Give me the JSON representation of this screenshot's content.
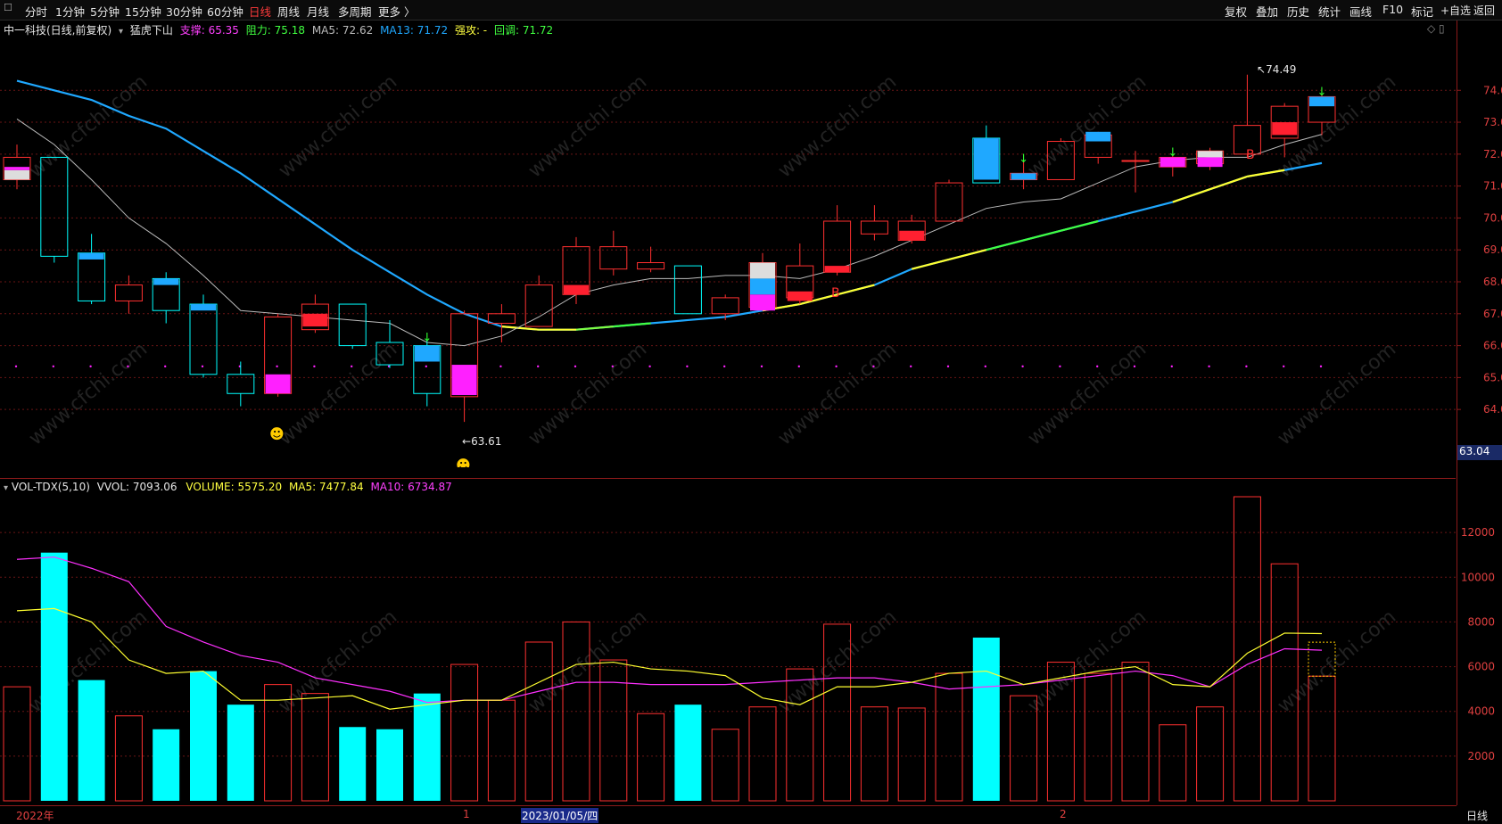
{
  "toolbar": {
    "periods": [
      "分时",
      "1分钟",
      "5分钟",
      "15分钟",
      "30分钟",
      "60分钟",
      "日线",
      "周线",
      "月线",
      "多周期",
      "更多 〉"
    ],
    "active_period": "日线",
    "right_buttons": [
      "复权",
      "叠加",
      "历史",
      "统计",
      "画线",
      "F10",
      "标记",
      "+自选",
      "返回"
    ]
  },
  "price_panel": {
    "stock_title": "中一科技(日线,前复权)",
    "indicator_name": "猛虎下山",
    "support_label": "支撑: 65.35",
    "resistance_label": "阻力: 75.18",
    "ma5_label": "MA5: 72.62",
    "ma13_label": "MA13: 71.72",
    "strong_attack_label": "强攻: -",
    "pullback_label": "回调: 71.72",
    "high_annotation": "74.49",
    "low_annotation": "63.61",
    "current_price_tag": "63.04",
    "buy_marker": "B"
  },
  "volume_panel": {
    "indicator_name": "VOL-TDX(5,10)",
    "vvol_label": "VVOL: 7093.06",
    "volume_label": "VOLUME: 5575.20",
    "ma5_label": "MA5: 7477.84",
    "ma10_label": "MA10: 6734.87"
  },
  "x_axis": {
    "year_label": "2022年",
    "month1_label": "1",
    "cursor_date": "2023/01/05/四",
    "month2_label": "2",
    "period_label": "日线"
  },
  "watermark": "www.cfchi.com",
  "colors": {
    "up": "#ff3030",
    "down": "#00ffff",
    "ma13": "#1fa8ff",
    "ma5": "#bbbbbb",
    "volume_ma5": "#ffff30",
    "volume_ma10": "#ff30ff",
    "accent_magenta": "#ff20ff"
  },
  "chart_data": [
    {
      "type": "candlestick",
      "y_ticks": [
        64.0,
        65.0,
        66.0,
        67.0,
        68.0,
        69.0,
        70.0,
        71.0,
        72.0,
        73.0,
        74.0
      ],
      "ylim": [
        62.3,
        75.6
      ],
      "support_level": 65.35,
      "candles": [
        {
          "o": 71.2,
          "c": 71.9,
          "h": 72.3,
          "l": 70.9
        },
        {
          "o": 71.9,
          "c": 68.8,
          "h": 71.9,
          "l": 68.6
        },
        {
          "o": 68.9,
          "c": 67.4,
          "h": 69.5,
          "l": 67.3
        },
        {
          "o": 67.4,
          "c": 67.9,
          "h": 68.2,
          "l": 67.0
        },
        {
          "o": 68.1,
          "c": 67.1,
          "h": 68.3,
          "l": 66.7
        },
        {
          "o": 67.3,
          "c": 65.1,
          "h": 67.6,
          "l": 65.0
        },
        {
          "o": 65.1,
          "c": 64.5,
          "h": 65.5,
          "l": 64.1
        },
        {
          "o": 64.5,
          "c": 66.9,
          "h": 67.0,
          "l": 64.4
        },
        {
          "o": 66.5,
          "c": 67.3,
          "h": 67.6,
          "l": 66.4
        },
        {
          "o": 67.3,
          "c": 66.0,
          "h": 67.3,
          "l": 65.9
        },
        {
          "o": 66.1,
          "c": 65.4,
          "h": 66.8,
          "l": 65.3
        },
        {
          "o": 66.0,
          "c": 64.5,
          "h": 66.2,
          "l": 64.1
        },
        {
          "o": 64.4,
          "c": 67.0,
          "h": 67.1,
          "l": 63.61
        },
        {
          "o": 66.7,
          "c": 67.0,
          "h": 67.3,
          "l": 66.1
        },
        {
          "o": 66.6,
          "c": 67.9,
          "h": 68.2,
          "l": 66.6
        },
        {
          "o": 67.6,
          "c": 69.1,
          "h": 69.4,
          "l": 67.3
        },
        {
          "o": 68.4,
          "c": 69.1,
          "h": 69.6,
          "l": 68.2
        },
        {
          "o": 68.4,
          "c": 68.6,
          "h": 69.1,
          "l": 68.3
        },
        {
          "o": 68.5,
          "c": 67.0,
          "h": 68.5,
          "l": 67.0
        },
        {
          "o": 67.0,
          "c": 67.5,
          "h": 67.6,
          "l": 66.8
        },
        {
          "o": 67.2,
          "c": 68.6,
          "h": 68.9,
          "l": 67.1
        },
        {
          "o": 67.5,
          "c": 68.5,
          "h": 69.2,
          "l": 67.3
        },
        {
          "o": 68.3,
          "c": 69.9,
          "h": 70.4,
          "l": 68.2
        },
        {
          "o": 69.5,
          "c": 69.9,
          "h": 70.4,
          "l": 69.3
        },
        {
          "o": 69.3,
          "c": 69.9,
          "h": 70.1,
          "l": 69.2
        },
        {
          "o": 69.9,
          "c": 71.1,
          "h": 71.2,
          "l": 69.9
        },
        {
          "o": 72.5,
          "c": 71.1,
          "h": 72.9,
          "l": 71.1
        },
        {
          "o": 71.2,
          "c": 71.4,
          "h": 71.8,
          "l": 70.9
        },
        {
          "o": 71.2,
          "c": 72.4,
          "h": 72.5,
          "l": 71.2
        },
        {
          "o": 71.9,
          "c": 72.6,
          "h": 72.7,
          "l": 71.7
        },
        {
          "o": 71.8,
          "c": 71.8,
          "h": 72.1,
          "l": 70.8
        },
        {
          "o": 71.6,
          "c": 71.9,
          "h": 72.0,
          "l": 71.3
        },
        {
          "o": 71.7,
          "c": 72.1,
          "h": 72.2,
          "l": 71.5
        },
        {
          "o": 72.0,
          "c": 72.9,
          "h": 74.49,
          "l": 71.9
        },
        {
          "o": 72.5,
          "c": 73.5,
          "h": 73.6,
          "l": 71.9
        },
        {
          "o": 73.0,
          "c": 73.8,
          "h": 73.9,
          "l": 72.6
        }
      ],
      "ma5": [
        73.1,
        72.3,
        71.2,
        70.0,
        69.2,
        68.2,
        67.1,
        67.0,
        66.9,
        66.8,
        66.7,
        66.1,
        66.0,
        66.3,
        66.9,
        67.6,
        67.9,
        68.1,
        68.1,
        68.2,
        68.2,
        68.1,
        68.4,
        68.8,
        69.3,
        69.8,
        70.3,
        70.5,
        70.6,
        71.1,
        71.6,
        71.8,
        71.9,
        71.9,
        72.3,
        72.62
      ],
      "ma13": [
        74.3,
        74.0,
        73.7,
        73.2,
        72.8,
        72.1,
        71.4,
        70.6,
        69.8,
        69.0,
        68.3,
        67.6,
        67.0,
        66.6,
        66.5,
        66.5,
        66.6,
        66.7,
        66.8,
        66.9,
        67.1,
        67.3,
        67.6,
        67.9,
        68.4,
        68.7,
        69.0,
        69.3,
        69.6,
        69.9,
        70.2,
        70.5,
        70.9,
        71.3,
        71.5,
        71.72
      ]
    },
    {
      "type": "bar",
      "y_ticks": [
        2000,
        4000,
        6000,
        8000,
        10000,
        12000
      ],
      "ylim": [
        0,
        13800
      ],
      "volumes": [
        5100,
        11100,
        5400,
        3800,
        3200,
        5800,
        4300,
        5200,
        4800,
        3300,
        3200,
        4800,
        6100,
        4500,
        7100,
        8000,
        6300,
        3900,
        4300,
        3200,
        4200,
        5900,
        7900,
        4200,
        4150,
        5700,
        7300,
        4700,
        6200,
        5700,
        6200,
        3400,
        4200,
        13600,
        10600,
        5575.2
      ],
      "ma5": [
        8500,
        8600,
        8000,
        6300,
        5700,
        5800,
        4500,
        4500,
        4600,
        4700,
        4100,
        4300,
        4500,
        4500,
        5300,
        6100,
        6200,
        5900,
        5800,
        5600,
        4600,
        4300,
        5100,
        5100,
        5300,
        5700,
        5800,
        5200,
        5500,
        5800,
        6000,
        5200,
        5100,
        6600,
        7500,
        7477.84
      ],
      "ma10": [
        10800,
        10900,
        10400,
        9800,
        7800,
        7100,
        6500,
        6200,
        5500,
        5200,
        4900,
        4400,
        4500,
        4500,
        4900,
        5300,
        5300,
        5200,
        5200,
        5200,
        5300,
        5400,
        5500,
        5500,
        5300,
        5000,
        5100,
        5200,
        5400,
        5600,
        5800,
        5600,
        5100,
        6100,
        6800,
        6734.87
      ]
    }
  ]
}
